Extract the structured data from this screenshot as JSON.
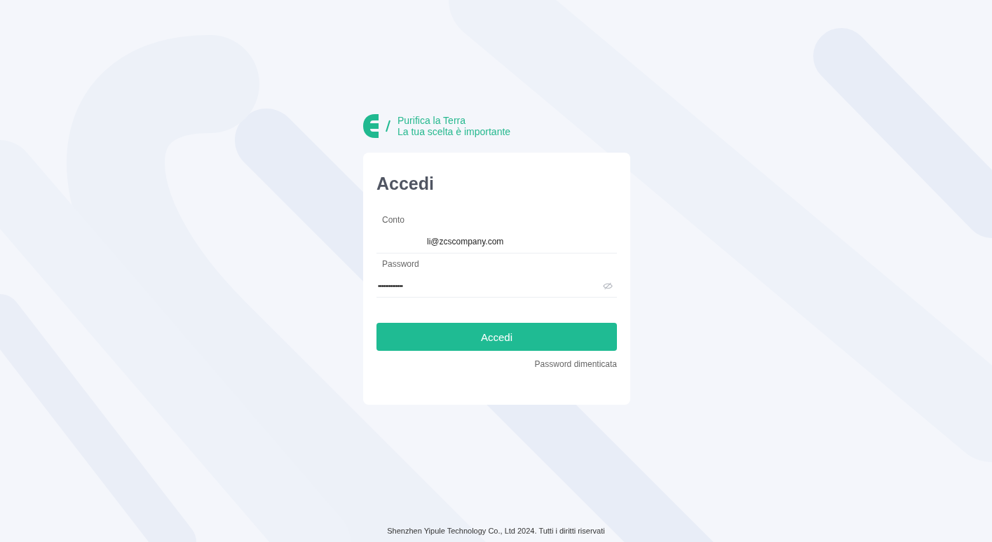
{
  "brand": {
    "line_1": "Purifica la Terra",
    "line_2": "La tua scelta è importante"
  },
  "login": {
    "title": "Accedi",
    "fields": [
      {
        "kind": "text",
        "label": "Conto",
        "value": "li@zcscompany.com"
      },
      {
        "kind": "password",
        "label": "Password",
        "value": "••••••••••••••"
      }
    ],
    "submit": "Accedi",
    "forgot_link": "Password dimenticata"
  },
  "footer": "Shenzhen Yipule Technology Co., Ltd 2024. Tutti i diritti riservati"
}
